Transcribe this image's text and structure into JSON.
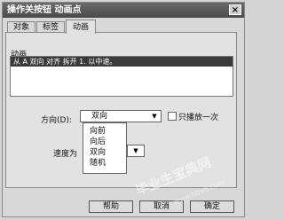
{
  "window": {
    "title": "操作关按钮 动画点",
    "close_label": "×"
  },
  "tabs": [
    {
      "label": "对象"
    },
    {
      "label": "标签"
    },
    {
      "label": "动画"
    }
  ],
  "animation": {
    "label": "动画",
    "list_item": "从 A 双向 对齐 拆开 1. 以中速。"
  },
  "direction": {
    "label": "方向(D):",
    "selected": "双向",
    "options": [
      "向前",
      "向后",
      "双向",
      "随机"
    ]
  },
  "checkbox": {
    "label": "只播放一次",
    "checked": false
  },
  "speed": {
    "label": "速度为"
  },
  "buttons": {
    "help": "帮助",
    "cancel": "取消",
    "ok": "确定"
  },
  "watermark": {
    "text": "毕业生宝典网",
    "url": "www.bbvb.com"
  },
  "icons": {
    "dropdown": "triangle-down-icon"
  }
}
